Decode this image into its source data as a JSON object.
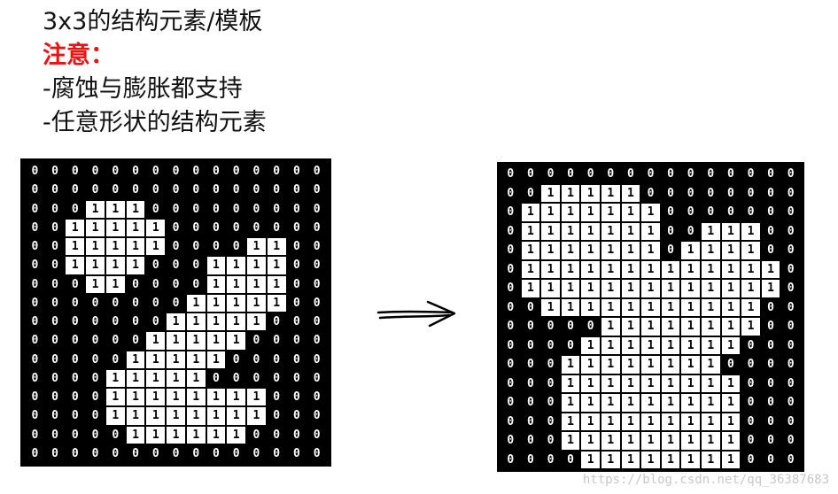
{
  "heading": {
    "line1": "3x3的结构元素/模板",
    "line2": "注意：",
    "line3": "-腐蚀与膨胀都支持",
    "line4": "-任意形状的结构元素"
  },
  "watermark": "https://blog.csdn.net/qq_36387683",
  "input_matrix": [
    "000000000000000",
    "000000000000000",
    "000111000000000",
    "001111100000000",
    "001111100001100",
    "001111000111100",
    "000110000111100",
    "000000001111100",
    "000000011111000",
    "000000111110000",
    "000001111100000",
    "000011111000000",
    "000011111111000",
    "000011111111000",
    "000001111110000",
    "000000000000000"
  ],
  "output_matrix": [
    "000000000000000",
    "001111100000000",
    "011111110000000",
    "011111110011100",
    "011111110111100",
    "011111111111110",
    "011111111111110",
    "001111111111100",
    "000001111111100",
    "000011111111000",
    "000111111110000",
    "000111111111000",
    "000111111111000",
    "000111111111000",
    "000111111111000",
    "000011111111000"
  ]
}
